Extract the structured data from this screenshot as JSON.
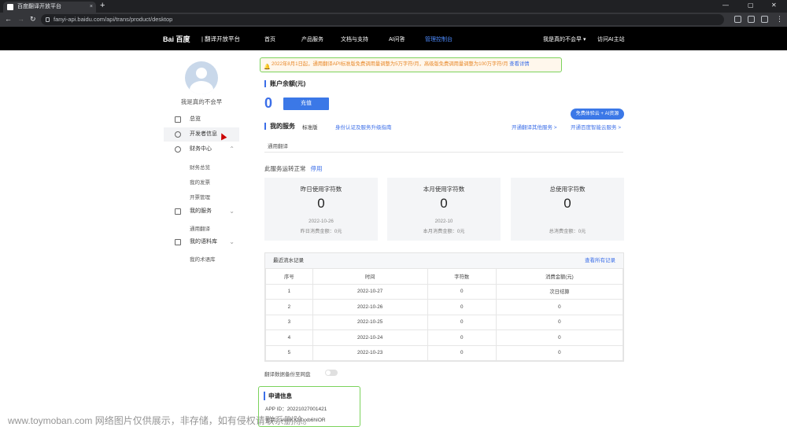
{
  "browser": {
    "tab_title": "百度翻译开放平台",
    "url": "fanyi-api.baidu.com/api/trans/product/desktop",
    "new_tab": "+",
    "tab_close": "×"
  },
  "topnav": {
    "logo": "Bai 百度",
    "logo_sub": "| 翻译开放平台",
    "items": [
      "首页",
      "产品服务",
      "文档与支持",
      "AI问答",
      "管理控制台"
    ],
    "user": "我是真的不会早 ▾",
    "ai_site": "访问AI主站"
  },
  "sidebar": {
    "username": "我是真的不会早",
    "items": [
      {
        "label": "总览"
      },
      {
        "label": "开发者信息"
      },
      {
        "label": "财务中心"
      },
      {
        "label": "我的服务"
      },
      {
        "label": "我的语料库"
      }
    ],
    "finance_sub": [
      "财务总览",
      "我的发票",
      "开票管理"
    ],
    "service_sub": [
      "通用翻译"
    ],
    "corpus_sub": [
      "我的术语库"
    ]
  },
  "notice": {
    "text": "2022年8月1日起，通用翻译API标准版免费调用量调整为5万字符/月，高级版免费调用量调整为100万字符/月",
    "link": "查看详情"
  },
  "account": {
    "title": "账户余额(元)",
    "balance": "0",
    "recharge": "充值",
    "promo": "免费体验云 + AI资源"
  },
  "services": {
    "title": "我的服务",
    "edition": "标准版",
    "guide": "身份认证及服务升级指南",
    "link_other": "开通翻译其他服务 >",
    "link_cloud": "开通百度智能云服务 >",
    "tab": "通用翻译",
    "status": "此服务运转正常",
    "stop": "停用"
  },
  "cards": [
    {
      "title": "昨日使用字符数",
      "value": "0",
      "date": "2022-10-26",
      "money": "昨日消费金额：0元"
    },
    {
      "title": "本月使用字符数",
      "value": "0",
      "date": "2022-10",
      "money": "本月消费金额：0元"
    },
    {
      "title": "总使用字符数",
      "value": "0",
      "date": "",
      "money": "总消费金额：0元"
    }
  ],
  "flow": {
    "title": "最近流水记录",
    "view_all": "查看所有记录",
    "columns": [
      "序号",
      "时间",
      "字符数",
      "消费金额(元)"
    ],
    "rows": [
      [
        "1",
        "2022-10-27",
        "0",
        "次日结算"
      ],
      [
        "2",
        "2022-10-26",
        "0",
        "0"
      ],
      [
        "3",
        "2022-10-25",
        "0",
        "0"
      ],
      [
        "4",
        "2022-10-24",
        "0",
        "0"
      ],
      [
        "5",
        "2022-10-23",
        "0",
        "0"
      ]
    ]
  },
  "backup": {
    "label": "翻译数据备份至网盘"
  },
  "apply": {
    "title": "申请信息",
    "appid": "APP ID：20221027001421",
    "appkey": "密钥：eU8KXzXxxb6hIOR"
  },
  "watermark": "www.toymoban.com 网络图片仅供展示，非存储，如有侵权请联系删除。",
  "colors": {
    "accent": "#3b6ee8",
    "highlight": "#7bd35c",
    "nav": "#000000"
  }
}
